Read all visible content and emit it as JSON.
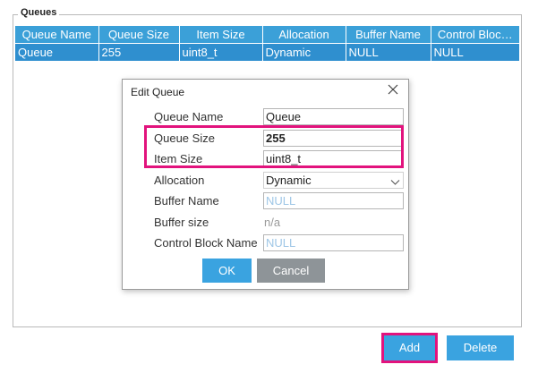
{
  "group": {
    "title": "Queues"
  },
  "table": {
    "headers": [
      "Queue Name",
      "Queue Size",
      "Item Size",
      "Allocation",
      "Buffer Name",
      "Control Bloc…"
    ],
    "rows": [
      [
        "Queue",
        "255",
        "uint8_t",
        "Dynamic",
        "NULL",
        "NULL"
      ]
    ]
  },
  "dialog": {
    "title": "Edit Queue",
    "close_icon": "close-icon",
    "fields": {
      "queue_name": {
        "label": "Queue Name",
        "value": "Queue"
      },
      "queue_size": {
        "label": "Queue Size",
        "value": "255"
      },
      "item_size": {
        "label": "Item Size",
        "value": "uint8_t"
      },
      "allocation": {
        "label": "Allocation",
        "value": "Dynamic"
      },
      "buffer_name": {
        "label": "Buffer Name",
        "placeholder": "NULL"
      },
      "buffer_size": {
        "label": "Buffer size",
        "value": "n/a"
      },
      "control_block_name": {
        "label": "Control Block Name",
        "placeholder": "NULL"
      }
    },
    "ok_label": "OK",
    "cancel_label": "Cancel"
  },
  "actions": {
    "add_label": "Add",
    "delete_label": "Delete"
  },
  "colors": {
    "header_bg": "#3ba0d8",
    "row_bg": "#2f8fcf",
    "button_blue": "#3aa3e0",
    "button_gray": "#8e9498",
    "highlight": "#e2137d",
    "placeholder": "#9ec6e6"
  }
}
